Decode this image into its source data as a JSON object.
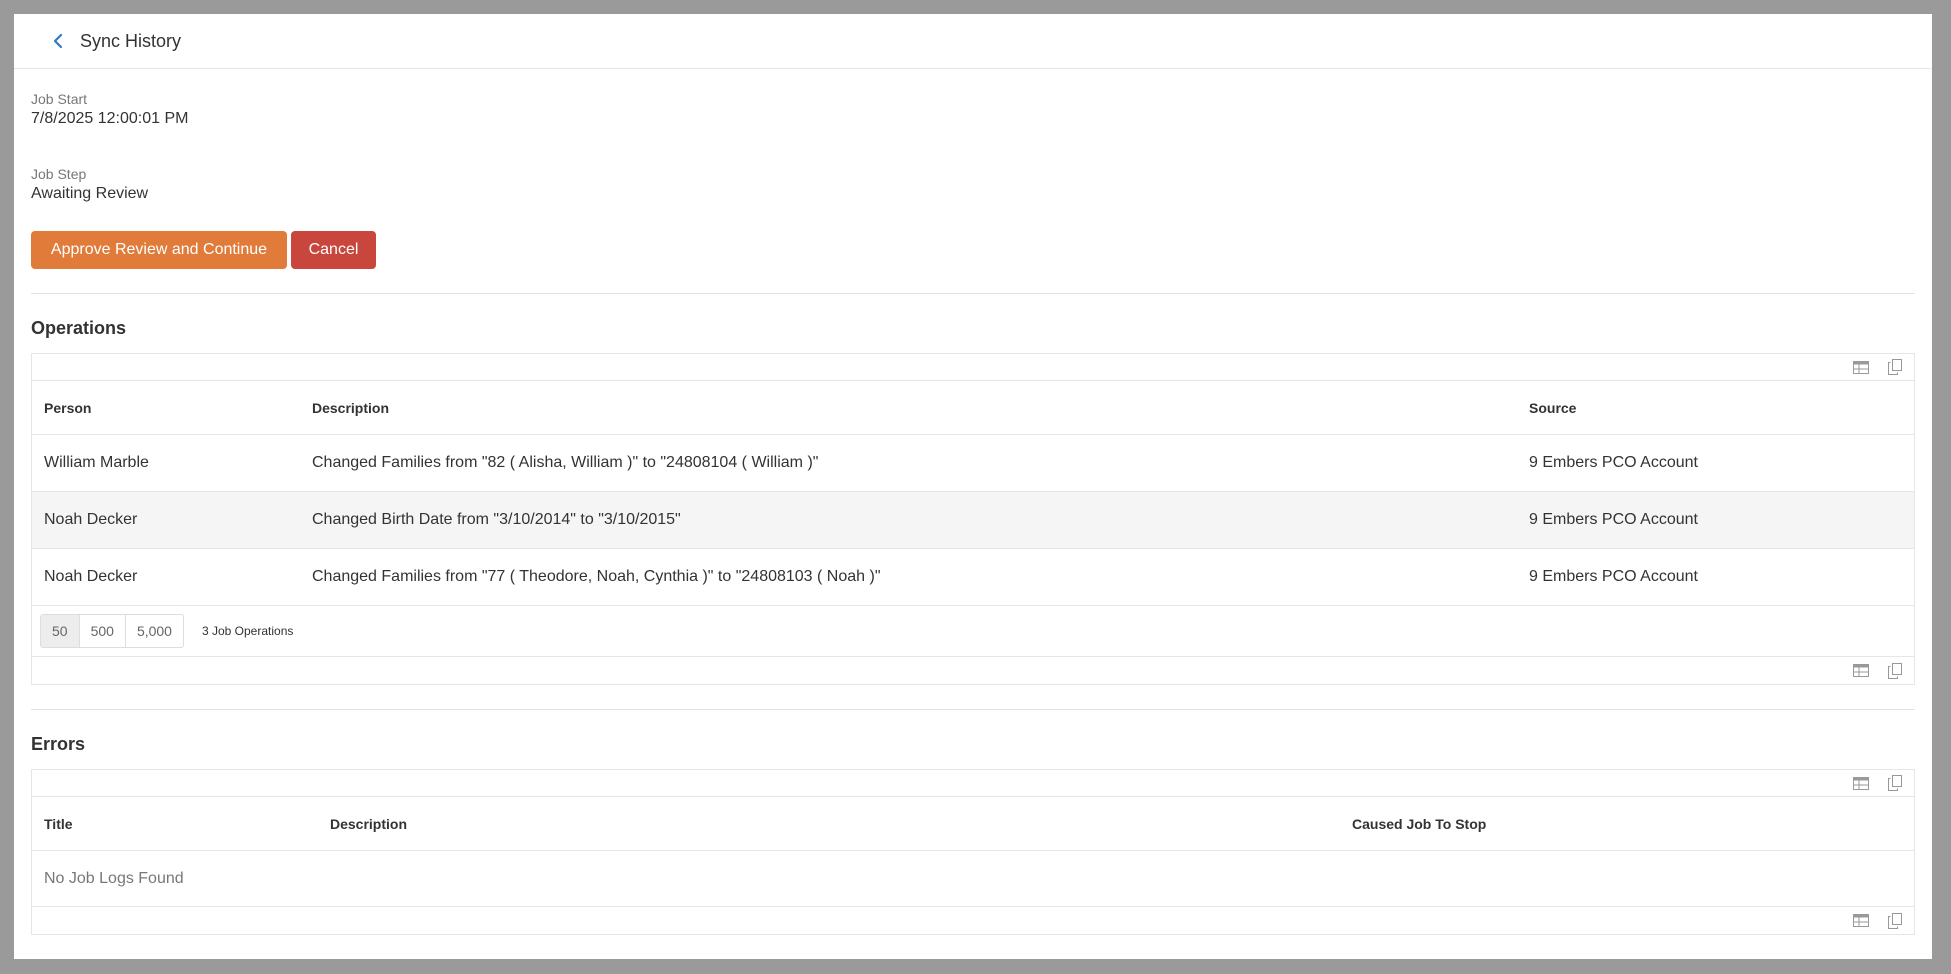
{
  "header": {
    "title": "Sync History"
  },
  "job": {
    "start_label": "Job Start",
    "start_value": "7/8/2025 12:00:01 PM",
    "step_label": "Job Step",
    "step_value": "Awaiting Review"
  },
  "actions": {
    "approve_label": "Approve Review and Continue",
    "cancel_label": "Cancel"
  },
  "operations": {
    "title": "Operations",
    "columns": [
      "Person",
      "Description",
      "Source"
    ],
    "rows": [
      {
        "person": "William Marble",
        "description": "Changed Families from \"82 ( Alisha, William )\" to \"24808104 ( William )\"",
        "source": "9 Embers PCO Account"
      },
      {
        "person": "Noah Decker",
        "description": "Changed Birth Date from \"3/10/2014\" to \"3/10/2015\"",
        "source": "9 Embers PCO Account"
      },
      {
        "person": "Noah Decker",
        "description": "Changed Families from \"77 ( Theodore, Noah, Cynthia )\" to \"24808103 ( Noah )\"",
        "source": "9 Embers PCO Account"
      }
    ],
    "page_sizes": [
      "50",
      "500",
      "5,000"
    ],
    "count_text": "3 Job Operations"
  },
  "errors": {
    "title": "Errors",
    "columns": [
      "Title",
      "Description",
      "Caused Job To Stop"
    ],
    "empty_text": "No Job Logs Found"
  },
  "colors": {
    "primary": "#e07b3a",
    "danger": "#c9463d",
    "back_icon": "#2f7bc4"
  },
  "icons": {
    "back": "chevron-left-icon",
    "grid_settings": "table-icon",
    "copy": "copy-icon"
  }
}
